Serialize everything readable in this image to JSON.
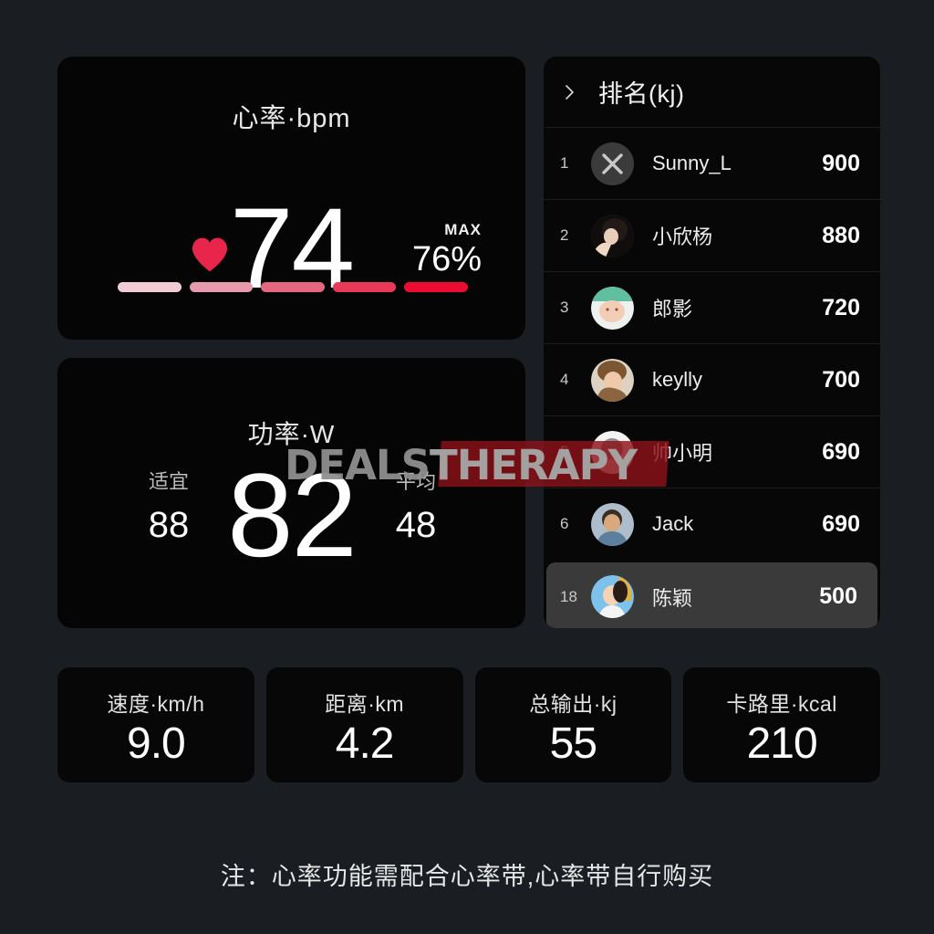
{
  "theme": {
    "page_bg": "#1a1e23",
    "card_bg": "#050505",
    "panel_bg": "#070707",
    "highlight_row_bg": "#3a3a3a",
    "accent_heart": "#e8254a",
    "text_primary": "#ffffff",
    "text_secondary": "#bdbdbd"
  },
  "heart_rate_card": {
    "title": "心率·bpm",
    "value": "74",
    "max_label": "MAX",
    "max_value": "76%",
    "heart_icon": "heart-icon",
    "zones": [
      {
        "name": "zone-1",
        "color": "#f2ccd4"
      },
      {
        "name": "zone-2",
        "color": "#e79aab"
      },
      {
        "name": "zone-3",
        "color": "#e4677f"
      },
      {
        "name": "zone-4",
        "color": "#e83a58"
      },
      {
        "name": "zone-5",
        "color": "#ec0b33"
      }
    ]
  },
  "power_card": {
    "title": "功率·W",
    "value": "82",
    "left_label": "适宜",
    "left_value": "88",
    "right_label": "平均",
    "right_value": "48"
  },
  "leaderboard": {
    "chevron_icon": "chevron-right-icon",
    "title": "排名(kj)",
    "rows": [
      {
        "rank": "1",
        "name": "Sunny_L",
        "score": "900",
        "avatar": "avatar-x-logo",
        "highlight": false
      },
      {
        "rank": "2",
        "name": "小欣杨",
        "score": "880",
        "avatar": "avatar-photo-2",
        "highlight": false
      },
      {
        "rank": "3",
        "name": "郎影",
        "score": "720",
        "avatar": "avatar-photo-3",
        "highlight": false
      },
      {
        "rank": "4",
        "name": "keylly",
        "score": "700",
        "avatar": "avatar-photo-4",
        "highlight": false
      },
      {
        "rank": "5",
        "name": "帅小明",
        "score": "690",
        "avatar": "avatar-photo-5",
        "highlight": false
      },
      {
        "rank": "6",
        "name": "Jack",
        "score": "690",
        "avatar": "avatar-photo-6",
        "highlight": false
      },
      {
        "rank": "18",
        "name": "陈颖",
        "score": "500",
        "avatar": "avatar-photo-18",
        "highlight": true
      }
    ]
  },
  "stats": [
    {
      "label": "速度·km/h",
      "value": "9.0"
    },
    {
      "label": "距离·km",
      "value": "4.2"
    },
    {
      "label": "总输出·kj",
      "value": "55"
    },
    {
      "label": "卡路里·kcal",
      "value": "210"
    }
  ],
  "footer": {
    "note": "注：心率功能需配合心率带,心率带自行购买"
  },
  "watermark": {
    "part1": "DEALS",
    "part2": "THERAPY"
  }
}
